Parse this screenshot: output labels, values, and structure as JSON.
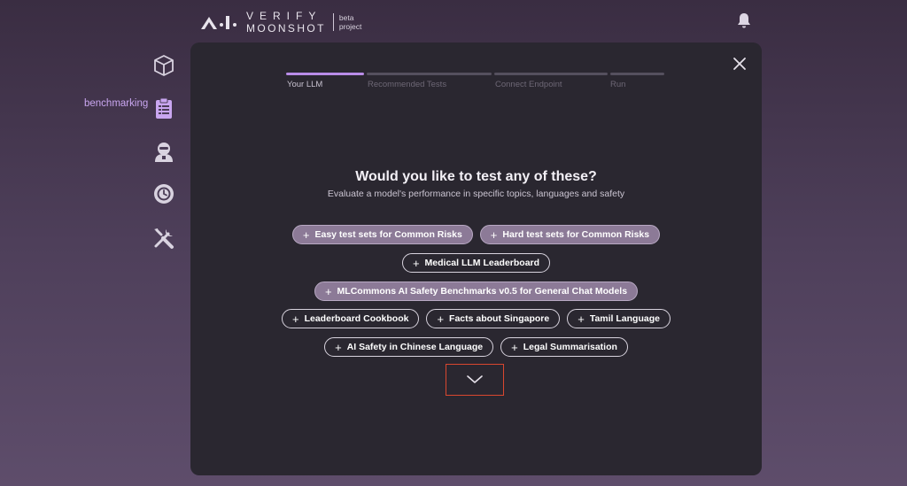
{
  "header": {
    "logo_verify": "VERIFY",
    "logo_moonshot": "MOONSHOT",
    "logo_beta": "beta",
    "logo_project": "project"
  },
  "sidebar": {
    "active_label": "benchmarking",
    "items": [
      {
        "icon": "cube-icon"
      },
      {
        "icon": "clipboard-icon",
        "label": "benchmarking",
        "active": true
      },
      {
        "icon": "red-team-icon"
      },
      {
        "icon": "history-icon"
      },
      {
        "icon": "tools-icon"
      }
    ]
  },
  "stepper": {
    "steps": [
      "Your LLM",
      "Recommended Tests",
      "Connect Endpoint",
      "Run"
    ],
    "active_index": 0
  },
  "dialog": {
    "title": "Would you like to test any of these?",
    "subtitle": "Evaluate a model's performance in specific topics, languages and safety",
    "options": [
      {
        "label": "Easy test sets for Common Risks",
        "selected": true
      },
      {
        "label": "Hard test sets for Common Risks",
        "selected": true
      },
      {
        "label": "Medical LLM Leaderboard",
        "selected": false
      },
      {
        "label": "MLCommons AI Safety Benchmarks v0.5 for General Chat Models",
        "selected": true
      },
      {
        "label": "Leaderboard Cookbook",
        "selected": false
      },
      {
        "label": "Facts about Singapore",
        "selected": false
      },
      {
        "label": "Tamil Language",
        "selected": false
      },
      {
        "label": "AI Safety in Chinese Language",
        "selected": false
      },
      {
        "label": "Legal Summarisation",
        "selected": false
      }
    ],
    "plus_symbol": "+"
  },
  "colors": {
    "accent": "#b98ce8",
    "modal_bg": "#2a2730",
    "pill_selected": "#8c7a97",
    "highlight_box": "#d9472f"
  }
}
